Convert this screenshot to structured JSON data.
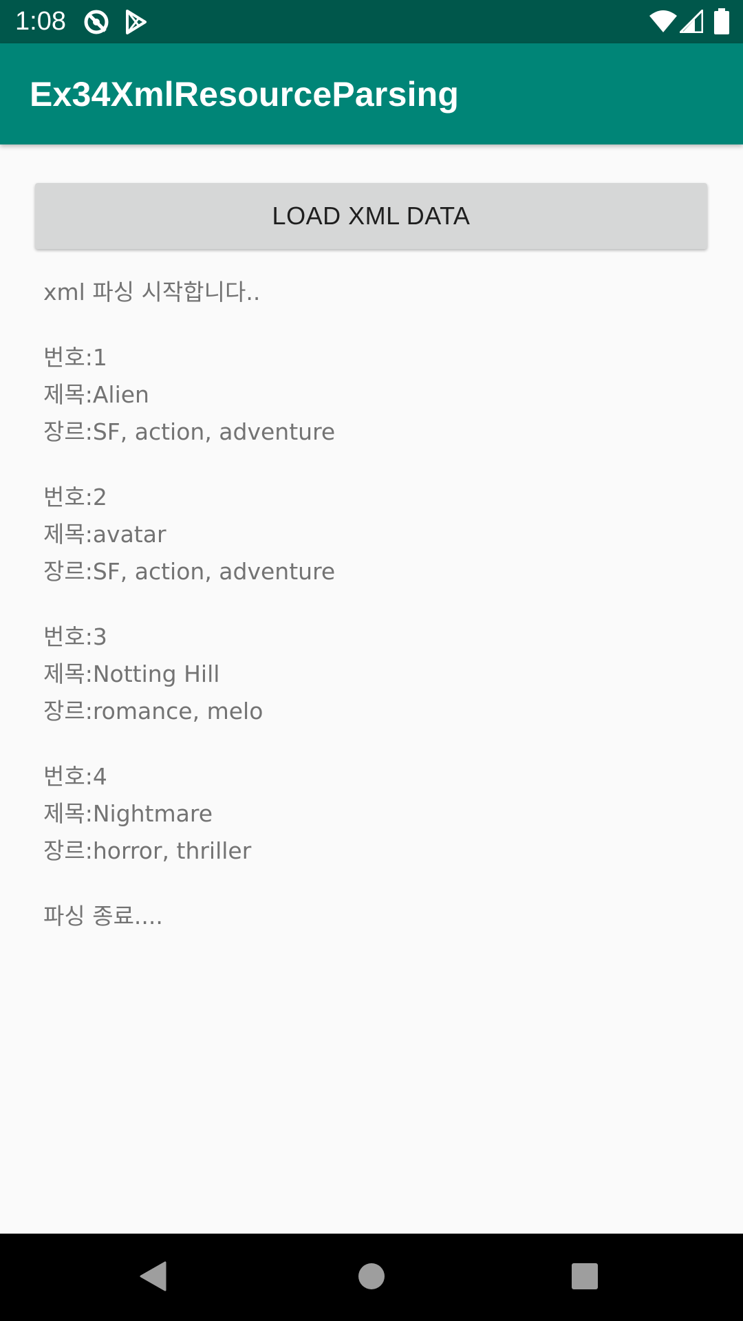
{
  "status_bar": {
    "time": "1:08",
    "icons": [
      "location-disabled-icon",
      "play-store-icon",
      "wifi-icon",
      "cellular-signal-icon",
      "battery-icon"
    ]
  },
  "app_bar": {
    "title": "Ex34XmlResourceParsing",
    "color": "#008577"
  },
  "status_bar_color": "#00574b",
  "button": {
    "label": "LOAD XML DATA"
  },
  "output": {
    "start": "xml 파싱 시작합니다..",
    "records": [
      {
        "number": "번호:1",
        "title": "제목:Alien",
        "genre": "장르:SF, action, adventure"
      },
      {
        "number": "번호:2",
        "title": "제목:avatar",
        "genre": "장르:SF, action, adventure"
      },
      {
        "number": "번호:3",
        "title": "제목:Notting Hill",
        "genre": "장르:romance, melo"
      },
      {
        "number": "번호:4",
        "title": "제목:Nightmare",
        "genre": "장르:horror, thriller"
      }
    ],
    "end": "파싱 종료...."
  },
  "nav_bar": {
    "icons": [
      "back-icon",
      "home-icon",
      "recents-icon"
    ]
  }
}
